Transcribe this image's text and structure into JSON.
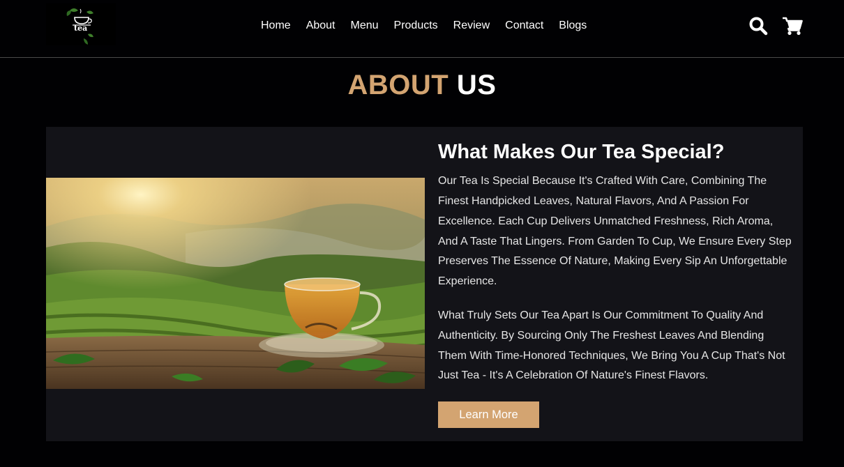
{
  "logo": {
    "text": "tea"
  },
  "nav": {
    "items": [
      {
        "label": "Home"
      },
      {
        "label": "About"
      },
      {
        "label": "Menu"
      },
      {
        "label": "Products"
      },
      {
        "label": "Review"
      },
      {
        "label": "Contact"
      },
      {
        "label": "Blogs"
      }
    ]
  },
  "icons": {
    "search": "search-icon",
    "cart": "cart-icon"
  },
  "section": {
    "title_accent": "ABOUT",
    "title_plain": "US"
  },
  "about": {
    "heading": "What Makes Our Tea Special?",
    "paragraph_1": "Our Tea Is Special Because It's Crafted With Care, Combining The Finest Handpicked Leaves, Natural Flavors, And A Passion For Excellence. Each Cup Delivers Unmatched Freshness, Rich Aroma, And A Taste That Lingers. From Garden To Cup, We Ensure Every Step Preserves The Essence Of Nature, Making Every Sip An Unforgettable Experience.",
    "paragraph_2": "What Truly Sets Our Tea Apart Is Our Commitment To Quality And Authenticity. By Sourcing Only The Freshest Leaves And Blending Them With Time-Honored Techniques, We Bring You A Cup That's Not Just Tea - It's A Celebration Of Nature's Finest Flavors.",
    "button_label": "Learn More"
  },
  "colors": {
    "accent": "#d3a471",
    "background": "#010103",
    "card": "#131318"
  }
}
